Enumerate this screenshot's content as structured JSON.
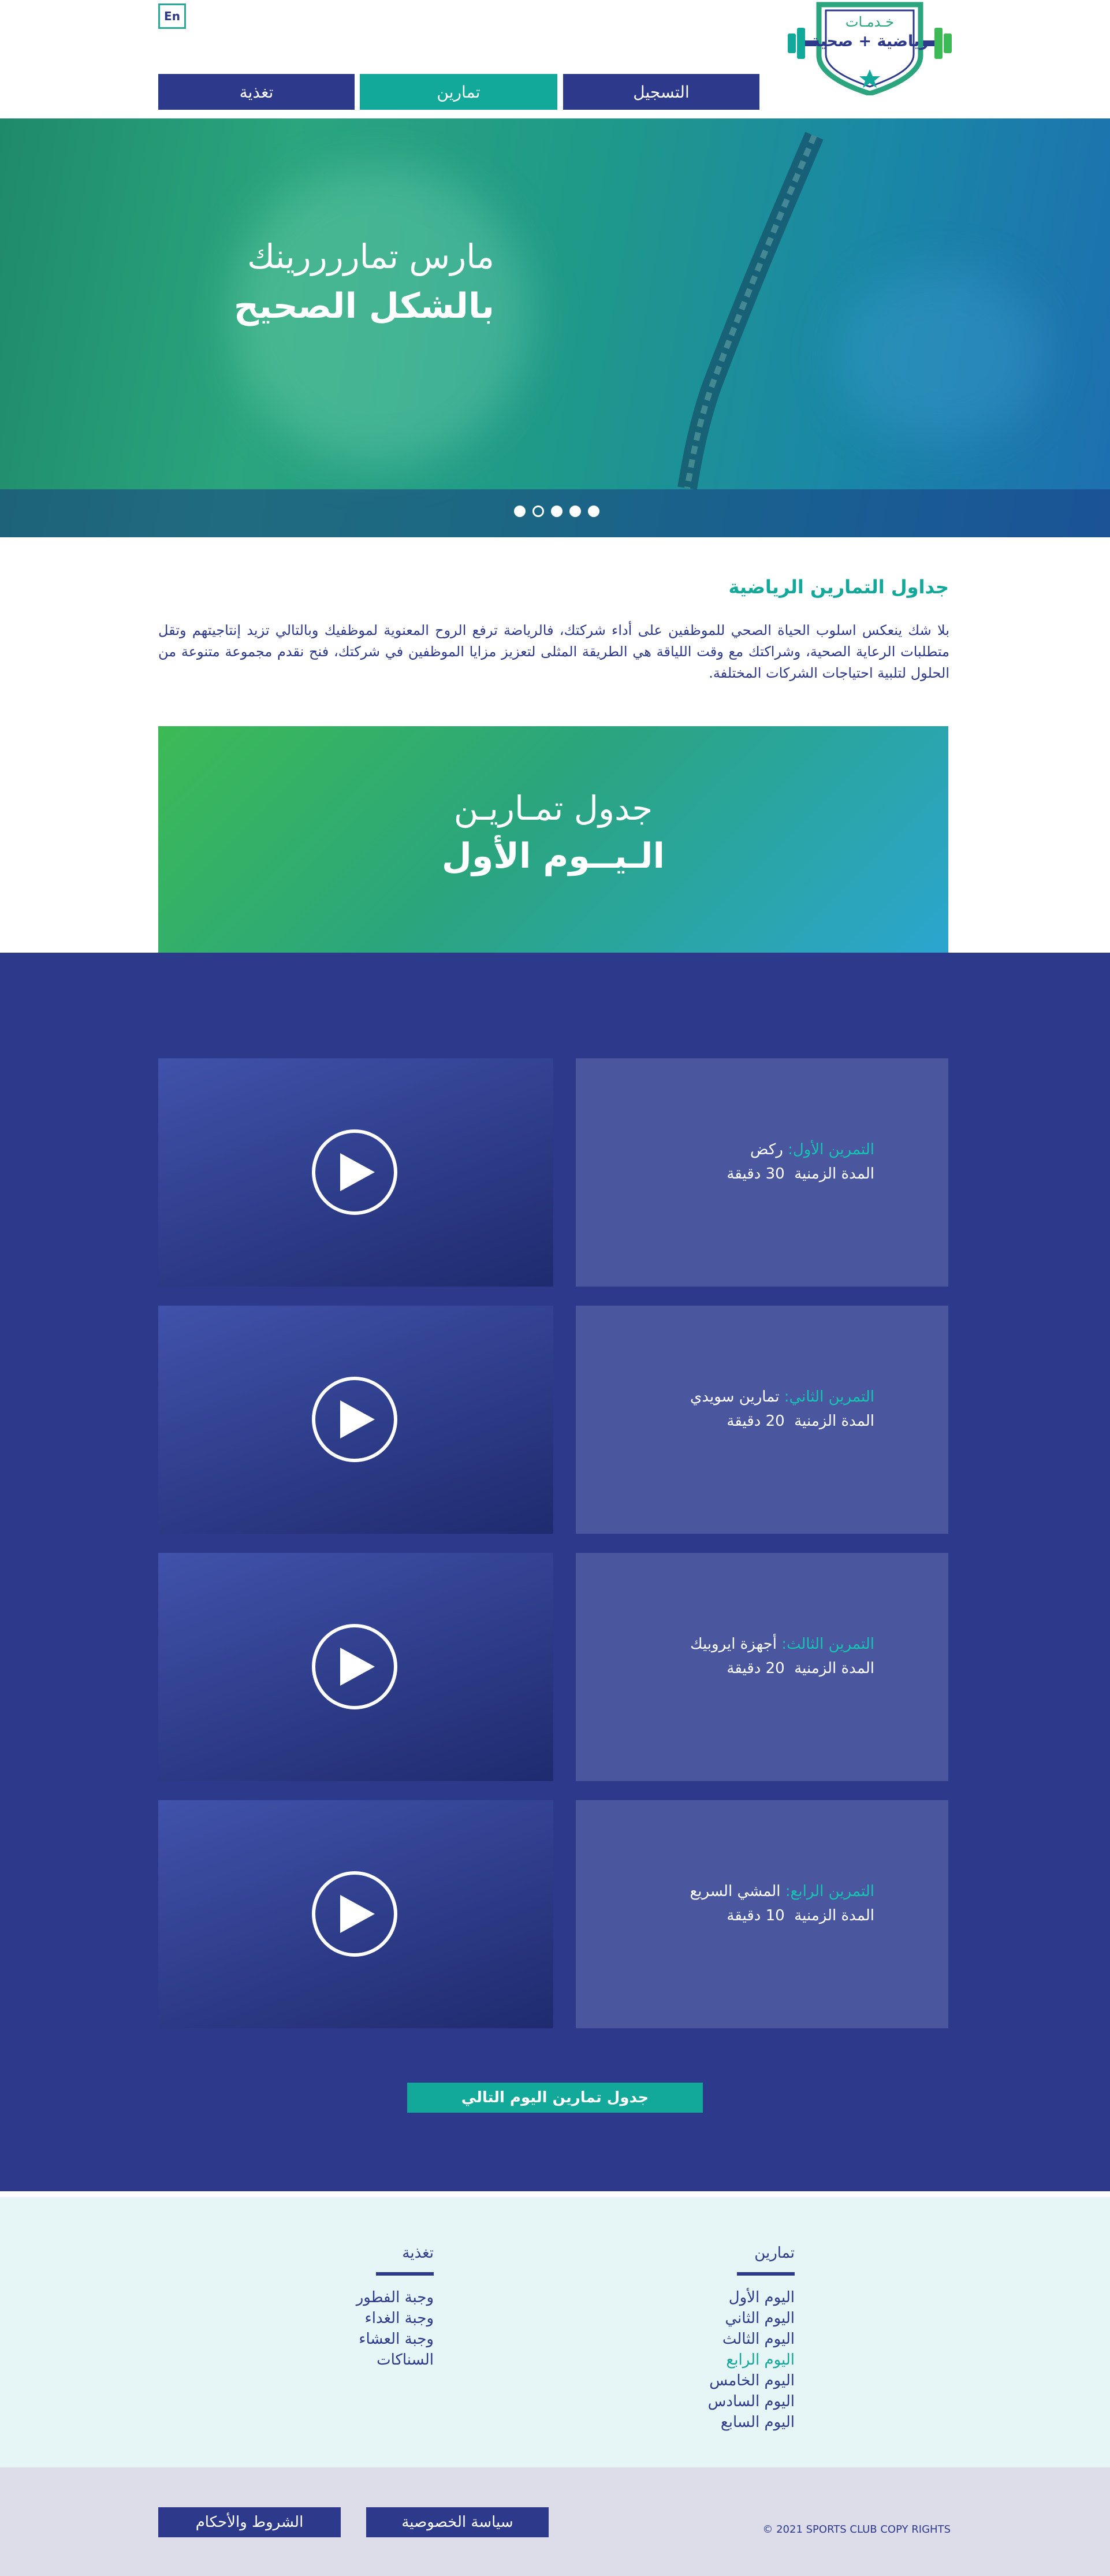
{
  "header": {
    "lang_button": "En",
    "logo_line1": "خـدمـات",
    "logo_line2": "رياضية + صحية",
    "nav": [
      {
        "label": "التسجيل"
      },
      {
        "label": "تمارين"
      },
      {
        "label": "تغذية"
      }
    ]
  },
  "hero": {
    "title_line1": "مارس تماررررينك",
    "title_line2": "بالشكل الصحيح",
    "slides_count": 5,
    "active_slide": 2
  },
  "intro": {
    "title": "جداول التمارين الرياضية",
    "text": "بلا شك ينعكس اسلوب الحياة الصحي للموظفين على أداء شركتك، فالرياضة ترفع الروح المعنوية لموظفيك وبالتالي تزيد إنتاجيتهم وتقل متطلبات الرعاية الصحية، وشراكتك مع وقت اللياقة هي الطريقة المثلى لتعزيز مزايا الموظفين في شركتك، فنح نقدم مجموعة متنوعة من الحلول لتلبية احتياجات الشركات المختلفة."
  },
  "banner": {
    "line1": "جدول تمـاريـن",
    "line2": "الـيــوم الأول"
  },
  "exercises": [
    {
      "label": "التمرين الأول:",
      "name": "ركض",
      "duration_label": "المدة الزمنية",
      "duration_value": "30 دقيقة"
    },
    {
      "label": "التمرين الثاني:",
      "name": "تمارين سويدي",
      "duration_label": "المدة الزمنية",
      "duration_value": "20 دقيقة"
    },
    {
      "label": "التمرين الثالث:",
      "name": "أجهزة ايروبيك",
      "duration_label": "المدة الزمنية",
      "duration_value": "20 دقيقة"
    },
    {
      "label": "التمرين الرابع:",
      "name": "المشي السريع",
      "duration_label": "المدة الزمنية",
      "duration_value": "10 دقيقة"
    }
  ],
  "next_button": "جدول تمارين اليوم التالي",
  "footer": {
    "training_col": {
      "title": "تمارين",
      "items": [
        "اليوم الأول",
        "اليوم الثاني",
        "اليوم الثالث",
        "اليوم الرابع",
        "اليوم الخامس",
        "اليوم السادس",
        "اليوم السابع"
      ],
      "active_index": 3
    },
    "nutrition_col": {
      "title": "تغذية",
      "items": [
        "وجبة الفطور",
        "وجبة الغداء",
        "وجبة العشاء",
        "السناكات"
      ]
    },
    "privacy_button": "سياسة الخصوصية",
    "terms_button": "الشروط والأحكام",
    "copyright": "© 2021 SPORTS CLUB COPY RIGHTS"
  },
  "colors": {
    "navy": "#2d3a8c",
    "teal": "#12a89a",
    "green": "#3dba55",
    "light_bg": "#e6f5f6"
  }
}
